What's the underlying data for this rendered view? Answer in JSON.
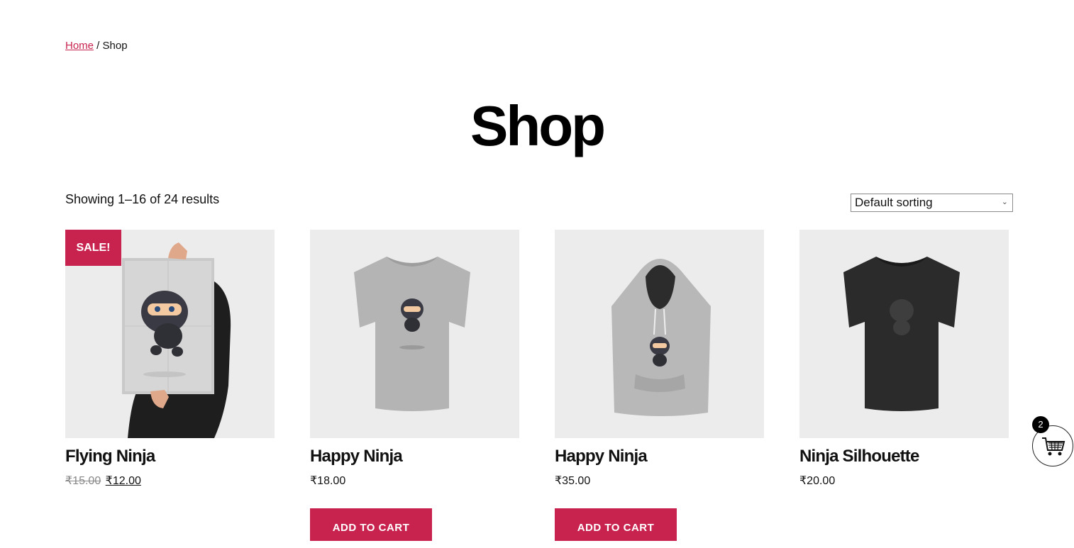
{
  "breadcrumb": {
    "home": "Home",
    "separator": " / ",
    "current": "Shop"
  },
  "page_title": "Shop",
  "result_count": "Showing 1–16 of 24 results",
  "orderby": {
    "selected": "Default sorting"
  },
  "accent_color": "#c8234f",
  "products": [
    {
      "name": "Flying Ninja",
      "badge": "SALE!",
      "regular_price": "₹15.00",
      "sale_price": "₹12.00",
      "image": "ninja-poster"
    },
    {
      "name": "Happy Ninja",
      "price": "₹18.00",
      "button": "ADD TO CART",
      "image": "grey-tshirt-ninja"
    },
    {
      "name": "Happy Ninja",
      "price": "₹35.00",
      "button": "ADD TO CART",
      "image": "grey-hoodie-ninja"
    },
    {
      "name": "Ninja Silhouette",
      "price": "₹20.00",
      "image": "black-tshirt-silhouette"
    }
  ],
  "cart": {
    "count": "2",
    "icon": "cart-icon"
  }
}
